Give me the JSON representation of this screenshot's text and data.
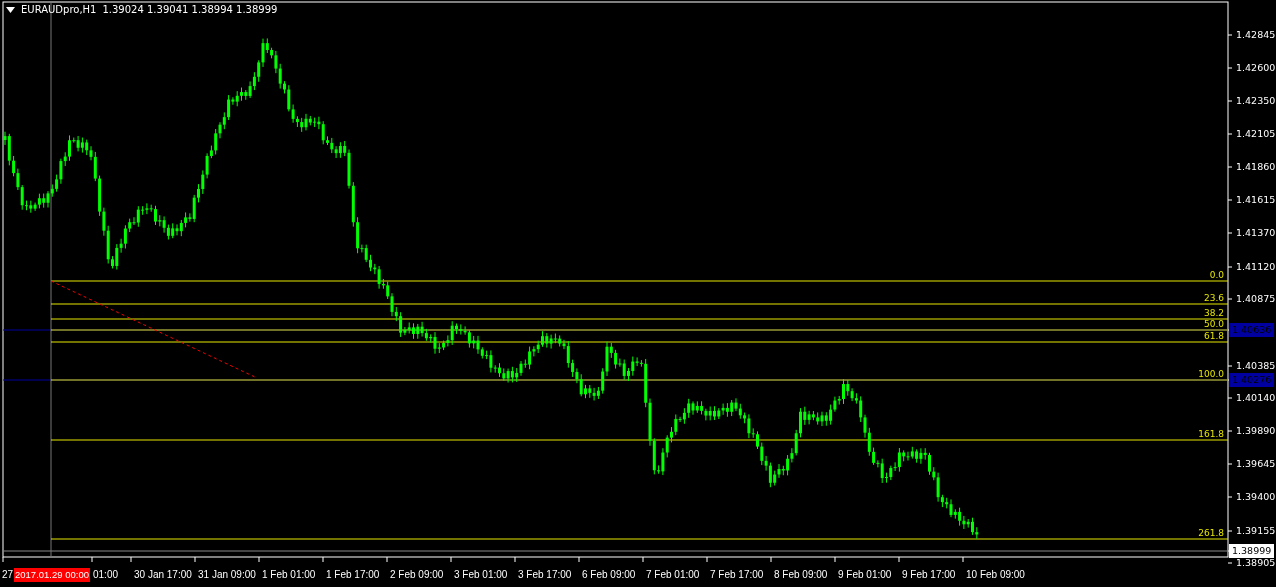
{
  "chart_header": {
    "symbol": "EURAUDpro,H1",
    "quotes": "1.39024 1.39041 1.38994 1.38999"
  },
  "price_axis": [
    {
      "label": "1.42845",
      "kind": "tick"
    },
    {
      "label": "1.42600",
      "kind": "tick"
    },
    {
      "label": "1.42350",
      "kind": "tick"
    },
    {
      "label": "1.42105",
      "kind": "tick"
    },
    {
      "label": "1.41860",
      "kind": "tick"
    },
    {
      "label": "1.41615",
      "kind": "tick"
    },
    {
      "label": "1.41370",
      "kind": "tick"
    },
    {
      "label": "1.41120",
      "kind": "tick"
    },
    {
      "label": "1.40875",
      "kind": "tick"
    },
    {
      "label": "1.40636",
      "kind": "line"
    },
    {
      "label": "1.40385",
      "kind": "tick"
    },
    {
      "label": "1.40276",
      "kind": "line"
    },
    {
      "label": "1.40140",
      "kind": "tick"
    },
    {
      "label": "1.39890",
      "kind": "tick"
    },
    {
      "label": "1.39645",
      "kind": "tick"
    },
    {
      "label": "1.39400",
      "kind": "tick"
    },
    {
      "label": "1.39155",
      "kind": "tick"
    },
    {
      "label": "1.38999",
      "kind": "bid"
    },
    {
      "label": "1.38905",
      "kind": "tick"
    }
  ],
  "fibonacci_levels": [
    {
      "label": "0.0"
    },
    {
      "label": "23.6"
    },
    {
      "label": "38.2"
    },
    {
      "label": "50.0"
    },
    {
      "label": "61.8"
    },
    {
      "label": "100.0"
    },
    {
      "label": "161.8"
    },
    {
      "label": "261.8"
    }
  ],
  "time_axis": [
    "27",
    "01:00",
    "30 Jan 17:00",
    "31 Jan 09:00",
    "1 Feb 01:00",
    "1 Feb 17:00",
    "2 Feb 09:00",
    "3 Feb 01:00",
    "3 Feb 17:00",
    "6 Feb 09:00",
    "7 Feb 01:00",
    "7 Feb 17:00",
    "8 Feb 09:00",
    "9 Feb 01:00",
    "9 Feb 17:00",
    "10 Feb 09:00"
  ],
  "crosshair_time": "2017.01.29 00:00"
}
